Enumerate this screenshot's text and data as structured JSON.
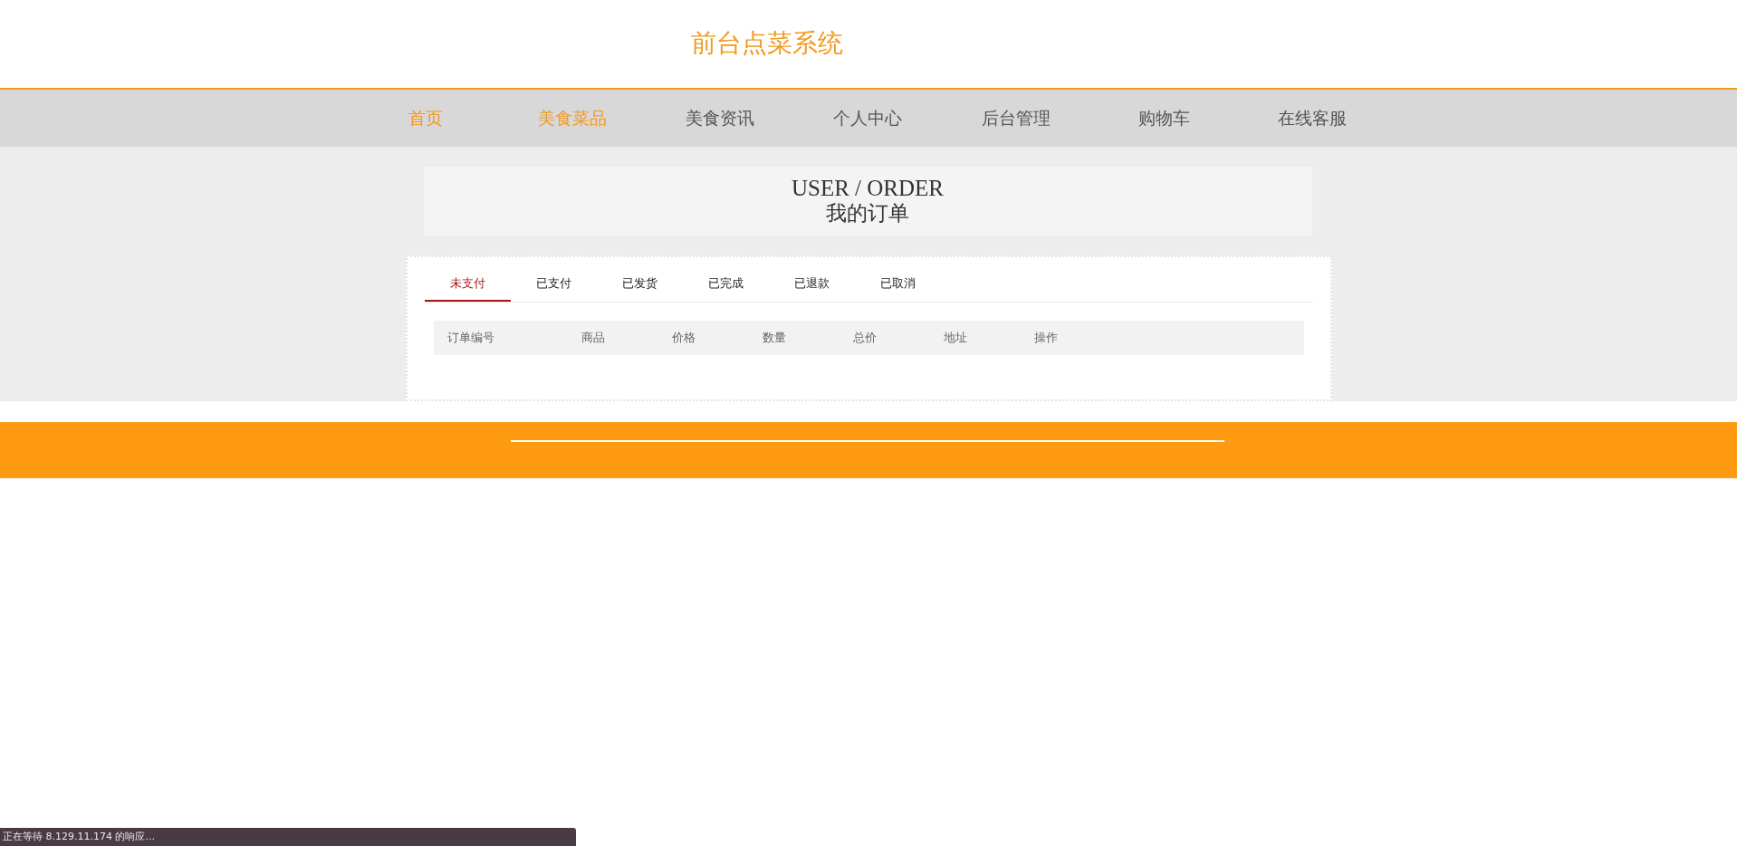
{
  "header": {
    "title": "前台点菜系统"
  },
  "nav": [
    {
      "label": "首页",
      "highlighted": true
    },
    {
      "label": "美食菜品",
      "highlighted": true
    },
    {
      "label": "美食资讯",
      "highlighted": false
    },
    {
      "label": "个人中心",
      "highlighted": false
    },
    {
      "label": "后台管理",
      "highlighted": false
    },
    {
      "label": "购物车",
      "highlighted": false
    },
    {
      "label": "在线客服",
      "highlighted": false
    }
  ],
  "page_heading": {
    "english": "USER / ORDER",
    "title": "我的订单"
  },
  "tabs": [
    {
      "label": "未支付",
      "selected": true
    },
    {
      "label": "已支付",
      "selected": false
    },
    {
      "label": "已发货",
      "selected": false
    },
    {
      "label": "已完成",
      "selected": false
    },
    {
      "label": "已退款",
      "selected": false
    },
    {
      "label": "已取消",
      "selected": false
    }
  ],
  "table": {
    "columns": [
      "订单编号",
      "商品",
      "价格",
      "数量",
      "总价",
      "地址",
      "操作"
    ]
  },
  "status_bar": {
    "text": "正在等待 8.129.11.174 的响应..."
  }
}
